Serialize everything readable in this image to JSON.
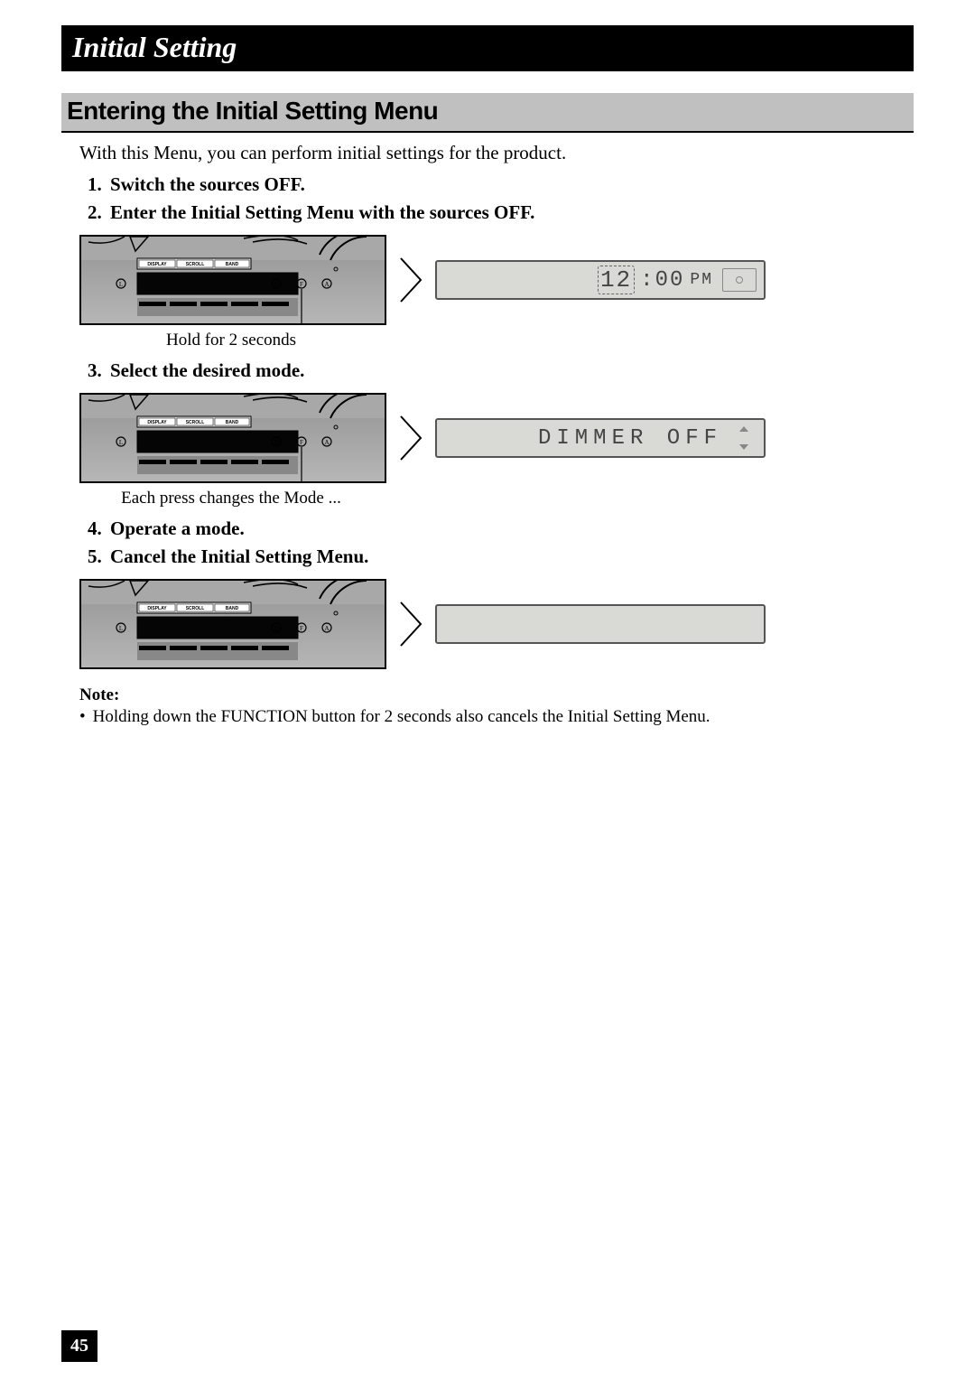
{
  "header": {
    "title": "Initial Setting"
  },
  "section": {
    "heading": "Entering the Initial Setting Menu"
  },
  "intro": "With this Menu, you can perform initial settings for the product.",
  "steps": {
    "s1": "Switch the sources OFF.",
    "s2": "Enter the Initial Setting Menu with the sources OFF.",
    "s3": "Select the desired mode.",
    "s4": "Operate a mode.",
    "s5": "Cancel the Initial Setting Menu."
  },
  "captions": {
    "c1": "Hold for 2 seconds",
    "c2": "Each press changes the Mode ..."
  },
  "display": {
    "clock_hour": "12",
    "clock_rest": ":00",
    "clock_ampm": "PM",
    "dimmer": "DIMMER OFF"
  },
  "device": {
    "buttons": {
      "b1": "DISPLAY",
      "b2": "SCROLL",
      "b3": "BAND"
    },
    "labels": {
      "l": "L",
      "d": "D",
      "f": "F",
      "a": "A"
    }
  },
  "note": {
    "heading": "Note:",
    "text": "Holding down the FUNCTION button for 2 seconds also cancels the Initial Setting Menu."
  },
  "page_number": "45"
}
